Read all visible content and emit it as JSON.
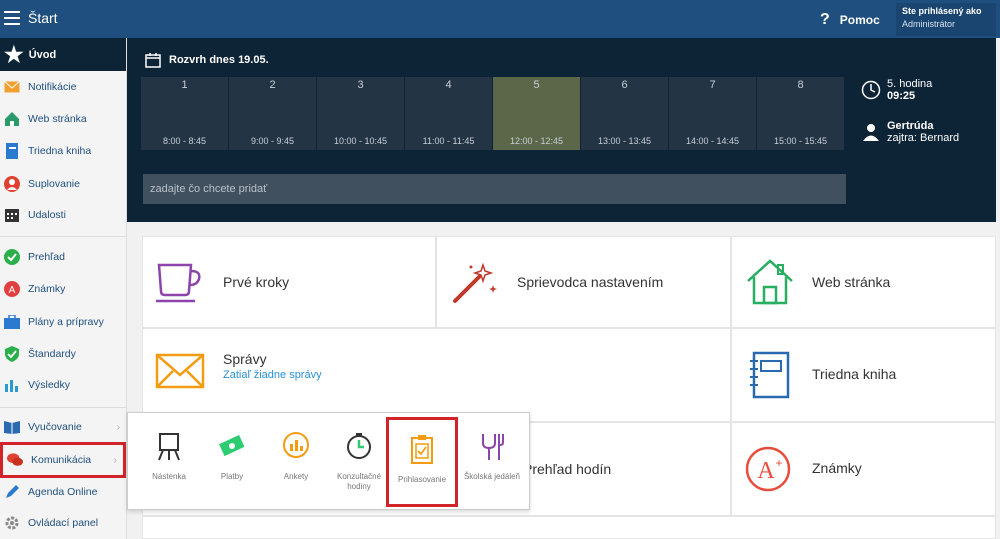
{
  "topbar": {
    "title": "Štart",
    "help_label": "Pomoc",
    "user_line1": "Ste prihlásený ako",
    "user_line2": "Administrátor"
  },
  "sidebar": {
    "header": "Úvod",
    "items": [
      {
        "label": "Notifikácie",
        "icon": "envelope-icon",
        "color": "#f0a030"
      },
      {
        "label": "Web stránka",
        "icon": "house-icon",
        "color": "#2a9a6a"
      },
      {
        "label": "Triedna kniha",
        "icon": "notebook-icon",
        "color": "#2a7ad0"
      },
      {
        "label": "Suplovanie",
        "icon": "person-icon",
        "color": "#e04030"
      },
      {
        "label": "Udalosti",
        "icon": "calendar-icon",
        "color": "#333333"
      },
      {
        "label": "Prehľad",
        "icon": "check-circle-icon",
        "color": "#2ab04a"
      },
      {
        "label": "Známky",
        "icon": "grade-icon",
        "color": "#e04040"
      },
      {
        "label": "Plány a prípravy",
        "icon": "briefcase-icon",
        "color": "#2a7ad0"
      },
      {
        "label": "Štandardy",
        "icon": "shield-icon",
        "color": "#2ab04a"
      },
      {
        "label": "Výsledky",
        "icon": "bar-chart-icon",
        "color": "#2a9ad0"
      },
      {
        "label": "Vyučovanie",
        "icon": "book-icon",
        "color": "#2a6ab0"
      },
      {
        "label": "Komunikácia",
        "icon": "chat-icon",
        "color": "#e04030"
      },
      {
        "label": "Agenda Online",
        "icon": "pen-icon",
        "color": "#2a7ad0"
      },
      {
        "label": "Ovládací panel",
        "icon": "gear-icon",
        "color": "#888888"
      }
    ]
  },
  "schedule": {
    "title": "Rozvrh dnes 19.05.",
    "periods": [
      {
        "num": "1",
        "time": "8:00 - 8:45"
      },
      {
        "num": "2",
        "time": "9:00 - 9:45"
      },
      {
        "num": "3",
        "time": "10:00 - 10:45"
      },
      {
        "num": "4",
        "time": "11:00 - 11:45"
      },
      {
        "num": "5",
        "time": "12:00 - 12:45"
      },
      {
        "num": "6",
        "time": "13:00 - 13:45"
      },
      {
        "num": "7",
        "time": "14:00 - 14:45"
      },
      {
        "num": "8",
        "time": "15:00 - 15:45"
      }
    ],
    "active_period": "5",
    "current_lesson": "5. hodina",
    "current_time": "09:25",
    "person_name": "Gertrúda",
    "person_next": "zajtra: Bernard",
    "input_placeholder": "zadajte čo chcete pridať"
  },
  "tiles": {
    "prve_kroky": "Prvé kroky",
    "sprievodca": "Sprievodca nastavením",
    "web_stranka": "Web stránka",
    "spravy": "Správy",
    "spravy_sub": "Zatiaľ žiadne správy",
    "triedna_kniha": "Triedna kniha",
    "prehlad_hodin": "Prehľad hodín",
    "znamky": "Známky"
  },
  "popup": {
    "items": [
      {
        "label": "Nástenka",
        "icon": "board-icon"
      },
      {
        "label": "Platby",
        "icon": "money-icon"
      },
      {
        "label": "Ankety",
        "icon": "poll-icon"
      },
      {
        "label": "Konzultačné hodiny",
        "icon": "clock-icon"
      },
      {
        "label": "Prihlasovanie",
        "icon": "clipboard-check-icon"
      },
      {
        "label": "Školská jedáleň",
        "icon": "cutlery-icon"
      }
    ]
  },
  "colors": {
    "topbar": "#1e4f7e",
    "dark_panel": "#0d2336",
    "highlight": "#d3232a",
    "link": "#2a8fd8"
  }
}
